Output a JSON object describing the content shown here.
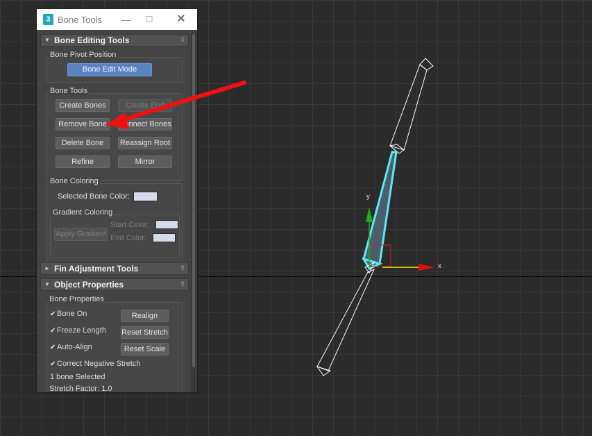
{
  "dialog": {
    "title": "Bone Tools",
    "app_icon": "3",
    "minimize": "—",
    "maximize": "☐",
    "close": "✕"
  },
  "bone_editing": {
    "title": "Bone Editing Tools",
    "pivot_group": "Bone Pivot Position",
    "edit_mode": "Bone Edit Mode",
    "tools_group": "Bone Tools",
    "create_bones": "Create Bones",
    "create_end": "Create End",
    "remove_bone": "Remove Bone",
    "connect_bones": "Connect Bones",
    "delete_bone": "Delete Bone",
    "reassign_root": "Reassign Root",
    "refine": "Refine",
    "mirror": "Mirror",
    "coloring_group": "Bone Coloring",
    "selected_color_label": "Selected Bone Color:",
    "gradient_group": "Gradient Coloring",
    "apply_gradient": "Apply Gradient",
    "start_color": "Start Color:",
    "end_color": "End Color:"
  },
  "fin_adjustment": {
    "title": "Fin Adjustment Tools"
  },
  "object_properties": {
    "title": "Object Properties",
    "group": "Bone Properties",
    "bone_on": "Bone On",
    "freeze_length": "Freeze Length",
    "auto_align": "Auto-Align",
    "correct_negative": "Correct Negative Stretch",
    "realign": "Realign",
    "reset_stretch": "Reset Stretch",
    "reset_scale": "Reset Scale",
    "status": "1 bone Selected",
    "stretch_factor": "Stretch Factor: 1.0"
  },
  "viewport": {
    "axis_x": "x",
    "axis_y": "y"
  },
  "colors": {
    "bone_selected": "#5ee8f5",
    "bone_wire": "#ffffff",
    "annotation_arrow": "#ee1111",
    "gizmo_x": "#ffee00",
    "gizmo_y": "#22aa22",
    "primary_button": "#5a83c2",
    "swatch": "#d5dbe8"
  }
}
